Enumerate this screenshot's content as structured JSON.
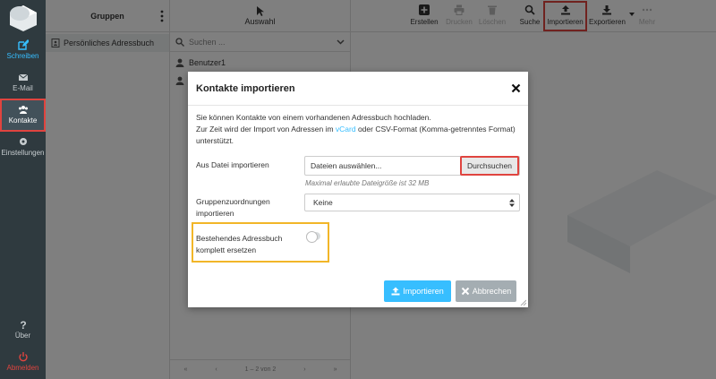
{
  "nav": {
    "items": [
      {
        "label": "Schreiben",
        "icon": "compose-icon"
      },
      {
        "label": "E-Mail",
        "icon": "mail-icon"
      },
      {
        "label": "Kontakte",
        "icon": "contacts-icon"
      },
      {
        "label": "Einstellungen",
        "icon": "gear-icon"
      },
      {
        "label": "Über",
        "icon": "question-icon"
      },
      {
        "label": "Abmelden",
        "icon": "power-icon"
      }
    ]
  },
  "groups": {
    "title": "Gruppen",
    "items": [
      {
        "label": "Persönliches Adressbuch"
      }
    ]
  },
  "contacts": {
    "select_label": "Auswahl",
    "search_placeholder": "Suchen ...",
    "items": [
      {
        "label": "Benutzer1"
      }
    ],
    "pager": "1 – 2 von 2"
  },
  "toolbar": {
    "create": "Erstellen",
    "print": "Drucken",
    "delete": "Löschen",
    "search": "Suche",
    "import": "Importieren",
    "export": "Exportieren",
    "more": "Mehr"
  },
  "dialog": {
    "title": "Kontakte importieren",
    "intro_line1": "Sie können Kontakte von einem vorhandenen Adressbuch hochladen.",
    "intro_line2a": "Zur Zeit wird der Import von Adressen im ",
    "intro_link": "vCard",
    "intro_line2b": " oder CSV-Format (Komma-getrenntes Format) unterstützt.",
    "file_label": "Aus Datei importieren",
    "file_placeholder": "Dateien auswählen...",
    "browse_label": "Durchsuchen",
    "max_size_hint": "Maximal erlaubte Dateigröße ist 32 MB",
    "group_label": "Gruppenzuordnungen importieren",
    "group_value": "Keine",
    "replace_label": "Bestehendes Adressbuch komplett ersetzen",
    "replace_enabled": false,
    "import_button": "Importieren",
    "cancel_button": "Abbrechen"
  },
  "colors": {
    "accent": "#37beff",
    "nav_bg": "#2f3a3f",
    "highlight_red": "#e0443f",
    "highlight_yellow": "#f2b628"
  }
}
